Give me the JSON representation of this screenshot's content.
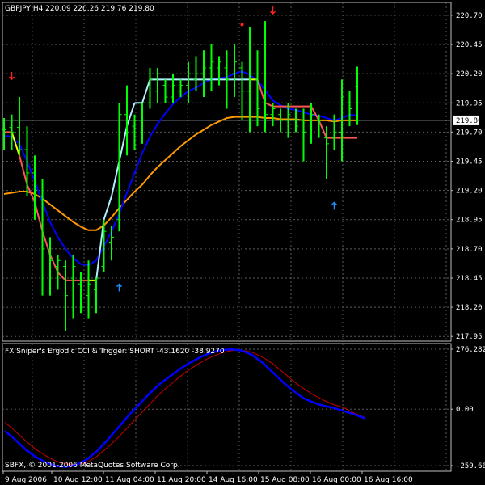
{
  "colors": {
    "background": "#000000",
    "grid": "#5a5a5a",
    "frame": "#bfbfbf",
    "bars": "#00ff00",
    "ma_fast": "#0000ff",
    "ma_slow": "#ff9900",
    "stair_up": "#aef0ff",
    "stair_yellow": "#ffff00",
    "stair_down": "#ff5555",
    "ergodic_cci": "#0000ff",
    "trigger": "#cc0000",
    "arrow_down": "#ff2222",
    "arrow_up": "#1e90ff",
    "price_line": "#8f9aa5"
  },
  "main_panel": {
    "header_text": "GBPJPY,H4  220.09 220.26 219.76 219.80",
    "current_price_label": "219.80"
  },
  "sub_panel": {
    "header_text": "FX Sniper's Ergodic CCI & Trigger: SHORT -43.1620 -38.9270",
    "copyright_text": "SBFX, © 2001-2006 MetaQuotes Software Corp."
  },
  "chart_data": [
    {
      "type": "bar",
      "symbol": "GBPJPY",
      "timeframe": "H4",
      "title": "GBPJPY,H4",
      "ohlc_header": {
        "open": 220.09,
        "high": 220.26,
        "low": 219.76,
        "close": 219.8
      },
      "y_ticks": [
        "220.70",
        "220.45",
        "220.20",
        "219.95",
        "219.70",
        "219.45",
        "219.20",
        "218.95",
        "218.70",
        "218.45",
        "218.20",
        "217.95"
      ],
      "ylim": [
        217.91,
        220.81
      ],
      "x_ticks": [
        "9 Aug 2006",
        "10 Aug 12:00",
        "11 Aug 04:00",
        "11 Aug 20:00",
        "14 Aug 16:00",
        "15 Aug 08:00",
        "16 Aug 00:00",
        "16 Aug 16:00"
      ],
      "current_price": 219.8,
      "grid": true,
      "bars": [
        {
          "h": 219.82,
          "l": 219.55,
          "o": 219.72,
          "c": 219.72
        },
        {
          "h": 219.85,
          "l": 219.55,
          "o": 219.74,
          "c": 219.7
        },
        {
          "h": 220.0,
          "l": 219.5,
          "o": 219.74,
          "c": 219.55
        },
        {
          "h": 219.75,
          "l": 219.15,
          "o": 219.55,
          "c": 219.35
        },
        {
          "h": 219.5,
          "l": 218.95,
          "o": 219.35,
          "c": 219.2
        },
        {
          "h": 219.3,
          "l": 218.3,
          "o": 219.15,
          "c": 218.7
        },
        {
          "h": 218.8,
          "l": 218.3,
          "o": 218.65,
          "c": 218.6
        },
        {
          "h": 218.65,
          "l": 218.35,
          "o": 218.55,
          "c": 218.6
        },
        {
          "h": 218.6,
          "l": 218.0,
          "o": 218.55,
          "c": 218.3
        },
        {
          "h": 218.65,
          "l": 218.1,
          "o": 218.45,
          "c": 218.55
        },
        {
          "h": 218.5,
          "l": 218.15,
          "o": 218.4,
          "c": 218.2
        },
        {
          "h": 218.6,
          "l": 218.1,
          "o": 218.3,
          "c": 218.4
        },
        {
          "h": 218.45,
          "l": 218.15,
          "o": 218.35,
          "c": 218.45
        },
        {
          "h": 218.95,
          "l": 218.5,
          "o": 218.55,
          "c": 218.85
        },
        {
          "h": 218.9,
          "l": 218.6,
          "o": 218.75,
          "c": 218.8
        },
        {
          "h": 219.95,
          "l": 218.85,
          "o": 218.95,
          "c": 219.85
        },
        {
          "h": 220.1,
          "l": 219.5,
          "o": 219.85,
          "c": 219.7
        },
        {
          "h": 219.85,
          "l": 219.55,
          "o": 219.75,
          "c": 219.8
        },
        {
          "h": 219.95,
          "l": 219.6,
          "o": 219.8,
          "c": 219.95
        },
        {
          "h": 220.25,
          "l": 219.9,
          "o": 219.95,
          "c": 220.15
        },
        {
          "h": 220.25,
          "l": 219.95,
          "o": 220.05,
          "c": 220.2
        },
        {
          "h": 220.15,
          "l": 219.95,
          "o": 220.1,
          "c": 220.0
        },
        {
          "h": 220.2,
          "l": 219.95,
          "o": 220.0,
          "c": 220.1
        },
        {
          "h": 220.15,
          "l": 220.0,
          "o": 220.05,
          "c": 220.1
        },
        {
          "h": 220.3,
          "l": 219.95,
          "o": 220.1,
          "c": 220.2
        },
        {
          "h": 220.35,
          "l": 220.05,
          "o": 220.15,
          "c": 220.2
        },
        {
          "h": 220.4,
          "l": 220.0,
          "o": 220.2,
          "c": 220.25
        },
        {
          "h": 220.45,
          "l": 220.05,
          "o": 220.25,
          "c": 220.3
        },
        {
          "h": 220.35,
          "l": 220.1,
          "o": 220.25,
          "c": 220.3
        },
        {
          "h": 220.4,
          "l": 219.9,
          "o": 220.25,
          "c": 220.15
        },
        {
          "h": 220.45,
          "l": 220.0,
          "o": 220.2,
          "c": 220.3
        },
        {
          "h": 220.3,
          "l": 219.8,
          "o": 220.25,
          "c": 220.05
        },
        {
          "h": 220.6,
          "l": 219.7,
          "o": 220.05,
          "c": 220.2
        },
        {
          "h": 220.4,
          "l": 219.75,
          "o": 220.15,
          "c": 219.9
        },
        {
          "h": 220.65,
          "l": 219.7,
          "o": 219.95,
          "c": 219.85
        },
        {
          "h": 219.95,
          "l": 219.75,
          "o": 219.85,
          "c": 219.9
        },
        {
          "h": 219.9,
          "l": 219.7,
          "o": 219.85,
          "c": 219.8
        },
        {
          "h": 219.95,
          "l": 219.65,
          "o": 219.8,
          "c": 219.85
        },
        {
          "h": 219.9,
          "l": 219.7,
          "o": 219.8,
          "c": 219.75
        },
        {
          "h": 219.9,
          "l": 219.45,
          "o": 219.8,
          "c": 219.7
        },
        {
          "h": 219.95,
          "l": 219.6,
          "o": 219.8,
          "c": 219.85
        },
        {
          "h": 219.85,
          "l": 219.65,
          "o": 219.8,
          "c": 219.8
        },
        {
          "h": 219.75,
          "l": 219.3,
          "o": 219.65,
          "c": 219.6
        },
        {
          "h": 219.85,
          "l": 219.55,
          "o": 219.65,
          "c": 219.7
        },
        {
          "h": 220.15,
          "l": 219.45,
          "o": 219.7,
          "c": 220.0
        },
        {
          "h": 220.05,
          "l": 219.75,
          "o": 219.95,
          "c": 219.9
        },
        {
          "h": 220.26,
          "l": 219.76,
          "o": 220.09,
          "c": 219.8
        }
      ],
      "ma_fast": [
        219.67,
        219.66,
        219.6,
        219.45,
        219.28,
        219.1,
        218.93,
        218.8,
        218.7,
        218.62,
        218.57,
        218.56,
        218.6,
        218.72,
        218.85,
        219.0,
        219.18,
        219.35,
        219.52,
        219.66,
        219.77,
        219.86,
        219.94,
        220.0,
        220.05,
        220.08,
        220.12,
        220.15,
        220.16,
        220.17,
        220.2,
        220.22,
        220.19,
        220.14,
        220.06,
        219.97,
        219.93,
        219.9,
        219.89,
        219.87,
        219.85,
        219.84,
        219.82,
        219.8,
        219.82,
        219.85,
        219.84
      ],
      "ma_slow": [
        219.17,
        219.18,
        219.19,
        219.19,
        219.17,
        219.13,
        219.08,
        219.03,
        218.98,
        218.93,
        218.89,
        218.86,
        218.86,
        218.9,
        218.97,
        219.05,
        219.12,
        219.19,
        219.25,
        219.33,
        219.4,
        219.46,
        219.52,
        219.58,
        219.63,
        219.68,
        219.72,
        219.76,
        219.79,
        219.82,
        219.83,
        219.83,
        219.83,
        219.83,
        219.82,
        219.82,
        219.81,
        219.81,
        219.81,
        219.8,
        219.8,
        219.8,
        219.8,
        219.79,
        219.8,
        219.8,
        219.8
      ],
      "stair_line": [
        {
          "v": 219.7,
          "c": "down"
        },
        {
          "v": 219.7,
          "c": "down"
        },
        {
          "v": 219.5,
          "c": "yellow"
        },
        {
          "v": 219.25,
          "c": "down"
        },
        {
          "v": 219.1,
          "c": "down"
        },
        {
          "v": 218.85,
          "c": "down"
        },
        {
          "v": 218.65,
          "c": "down"
        },
        {
          "v": 218.5,
          "c": "down"
        },
        {
          "v": 218.43,
          "c": "down"
        },
        {
          "v": 218.43,
          "c": "down"
        },
        {
          "v": 218.43,
          "c": "down"
        },
        {
          "v": 218.43,
          "c": "down"
        },
        {
          "v": 218.43,
          "c": "yellow"
        },
        {
          "v": 218.95,
          "c": "up"
        },
        {
          "v": 219.15,
          "c": "up"
        },
        {
          "v": 219.45,
          "c": "up"
        },
        {
          "v": 219.75,
          "c": "up"
        },
        {
          "v": 219.95,
          "c": "up"
        },
        {
          "v": 219.95,
          "c": "up"
        },
        {
          "v": 220.15,
          "c": "up"
        },
        {
          "v": 220.15,
          "c": "up"
        },
        {
          "v": 220.15,
          "c": "up"
        },
        {
          "v": 220.15,
          "c": "up"
        },
        {
          "v": 220.15,
          "c": "up"
        },
        {
          "v": 220.15,
          "c": "up"
        },
        {
          "v": 220.15,
          "c": "up"
        },
        {
          "v": 220.15,
          "c": "up"
        },
        {
          "v": 220.15,
          "c": "up"
        },
        {
          "v": 220.15,
          "c": "up"
        },
        {
          "v": 220.15,
          "c": "up"
        },
        {
          "v": 220.15,
          "c": "up"
        },
        {
          "v": 220.15,
          "c": "up"
        },
        {
          "v": 220.15,
          "c": "up"
        },
        {
          "v": 220.15,
          "c": "yellow"
        },
        {
          "v": 219.95,
          "c": "down"
        },
        {
          "v": 219.92,
          "c": "down"
        },
        {
          "v": 219.92,
          "c": "down"
        },
        {
          "v": 219.92,
          "c": "down"
        },
        {
          "v": 219.92,
          "c": "down"
        },
        {
          "v": 219.92,
          "c": "down"
        },
        {
          "v": 219.92,
          "c": "down"
        },
        {
          "v": 219.8,
          "c": "down"
        },
        {
          "v": 219.65,
          "c": "down"
        },
        {
          "v": 219.65,
          "c": "down"
        },
        {
          "v": 219.65,
          "c": "down"
        },
        {
          "v": 219.65,
          "c": "down"
        },
        {
          "v": 219.65,
          "c": "down"
        }
      ],
      "signals": [
        {
          "bar": 1,
          "type": "down",
          "price": 220.18
        },
        {
          "bar": 15,
          "type": "up",
          "price": 218.37
        },
        {
          "bar": 31,
          "type": "dot",
          "price": 220.62
        },
        {
          "bar": 35,
          "type": "down",
          "price": 220.74
        },
        {
          "bar": 43,
          "type": "up",
          "price": 219.07
        }
      ]
    },
    {
      "type": "line",
      "title": "FX Sniper's Ergodic CCI & Trigger",
      "y_ticks": [
        "276.2824",
        "0.00",
        "-259.667"
      ],
      "ylim": [
        -259.667,
        276.2824
      ],
      "series": [
        {
          "name": "Ergodic CCI",
          "color": "#0000ff",
          "values": [
            -100,
            -140,
            -185,
            -220,
            -245,
            -262,
            -265,
            -255,
            -230,
            -190,
            -140,
            -85,
            -30,
            20,
            70,
            115,
            150,
            185,
            215,
            240,
            260,
            272,
            276,
            270,
            250,
            215,
            170,
            125,
            85,
            50,
            30,
            15,
            5,
            -10,
            -25,
            -43.162
          ]
        },
        {
          "name": "Trigger",
          "color": "#cc0000",
          "values": [
            -60,
            -100,
            -145,
            -185,
            -215,
            -240,
            -252,
            -255,
            -245,
            -215,
            -175,
            -130,
            -80,
            -30,
            20,
            70,
            110,
            150,
            185,
            215,
            240,
            258,
            270,
            272,
            262,
            240,
            210,
            170,
            130,
            95,
            65,
            40,
            20,
            5,
            -20,
            -38.927
          ]
        }
      ]
    }
  ]
}
